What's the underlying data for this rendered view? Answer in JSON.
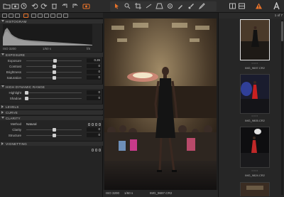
{
  "toolbar": {
    "icons": [
      "folder-icon",
      "camera-icon",
      "history-icon",
      "undo-icon",
      "redo-icon",
      "trash-icon",
      "rotate-left-icon",
      "rotate-right-icon",
      "import-icon",
      "pan-icon",
      "zoom-icon",
      "crop-icon",
      "straighten-icon",
      "keystone-icon",
      "spot-icon",
      "picker-icon",
      "brush-icon",
      "grid-icon",
      "layout-icon",
      "warning-icon",
      "export-icon"
    ],
    "accent_color": "#e8732a"
  },
  "histogram": {
    "title": "HISTOGRAM",
    "iso": "ISO 3200",
    "shutter": "1/60 s",
    "aperture": "f/8"
  },
  "exposure": {
    "title": "EXPOSURE",
    "rows": [
      {
        "label": "Exposure",
        "value": "0.26",
        "level": 0.52
      },
      {
        "label": "Contrast",
        "value": "0",
        "level": 0.5
      },
      {
        "label": "Brightness",
        "value": "0",
        "level": 0.5
      },
      {
        "label": "Saturation",
        "value": "0",
        "level": 0.5
      }
    ]
  },
  "hdr": {
    "title": "HIGH DYNAMIC RANGE",
    "rows": [
      {
        "label": "Highlight",
        "value": "0",
        "level": 0.0
      },
      {
        "label": "Shadow",
        "value": "0",
        "level": 0.0
      }
    ]
  },
  "sections": {
    "levels": "LEVELS",
    "curve": "CURVE",
    "clarity": "CLARITY",
    "vignetting": "VIGNETTING"
  },
  "clarity": {
    "method_label": "Method",
    "method_value": "Natural",
    "rows": [
      {
        "label": "Clarity",
        "value": "0",
        "level": 0.5
      },
      {
        "label": "Structure",
        "value": "0",
        "level": 0.5
      }
    ]
  },
  "viewer": {
    "iso": "ISO 3200",
    "shutter": "1/60 s",
    "filename": "IMG_9697.CR2"
  },
  "browser": {
    "count": "1 of 7",
    "thumbnails": [
      {
        "name": "IMG_9697.CR2",
        "selected": true
      },
      {
        "name": "IMG_9805.CR2",
        "selected": false
      },
      {
        "name": "IMG_9824.CR2",
        "selected": false
      },
      {
        "name": "",
        "selected": false
      }
    ]
  }
}
